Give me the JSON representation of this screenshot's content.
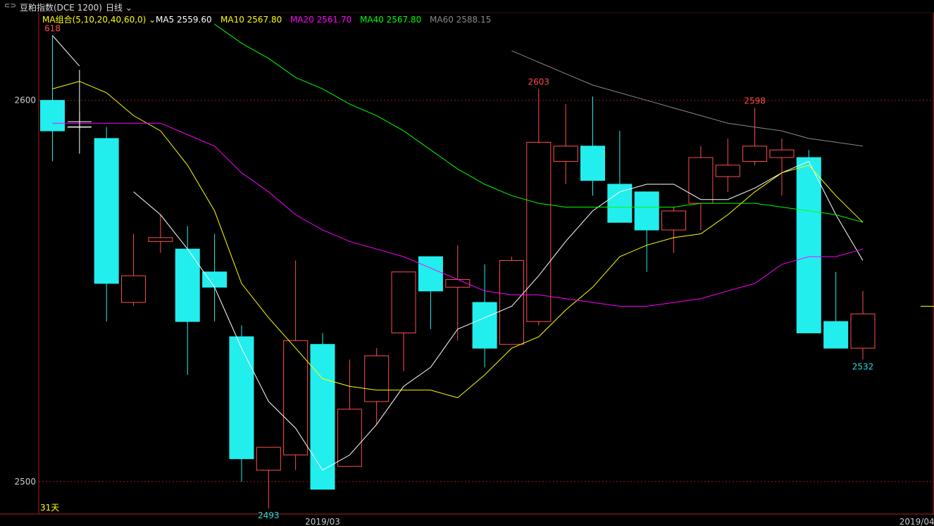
{
  "header": {
    "link_icon": "link-icon",
    "instrument": "豆粕指数(DCE 1200)",
    "period": "日线",
    "period_icon": "chevron-down-icon"
  },
  "legend": {
    "group": "MA组合(5,10,20,40,60,0)",
    "group_icon": "chevron-down-icon",
    "items": [
      {
        "text": "MA5 2559.60",
        "color": "#ffffff"
      },
      {
        "text": "MA10 2567.80",
        "color": "#ffff00"
      },
      {
        "text": "MA20 2561.70",
        "color": "#ff00ff"
      },
      {
        "text": "MA40 2567.80",
        "color": "#00ff00"
      },
      {
        "text": "MA60 2588.15",
        "color": "#888888"
      }
    ]
  },
  "chart_data": {
    "type": "candlestick",
    "ylim": [
      2491.5,
      2623
    ],
    "y_ticks": [
      2500,
      2600
    ],
    "x_ticks": [
      {
        "label": "2019/03",
        "index": 10
      },
      {
        "label": "2019/04",
        "index": 32
      }
    ],
    "candles": [
      {
        "open": 2600,
        "high": 2617,
        "low": 2584,
        "close": 2592
      },
      {
        "open": 2593,
        "high": 2608,
        "low": 2586,
        "close": 2593
      },
      {
        "open": 2590,
        "high": 2593,
        "low": 2542,
        "close": 2552
      },
      {
        "open": 2547,
        "high": 2565,
        "low": 2546,
        "close": 2554
      },
      {
        "open": 2563,
        "high": 2570,
        "low": 2560,
        "close": 2564
      },
      {
        "open": 2561,
        "high": 2567,
        "low": 2528,
        "close": 2542
      },
      {
        "open": 2555,
        "high": 2565,
        "low": 2542,
        "close": 2551
      },
      {
        "open": 2538,
        "high": 2541,
        "low": 2500,
        "close": 2506
      },
      {
        "open": 2503,
        "high": 2508,
        "low": 2493,
        "close": 2509
      },
      {
        "open": 2507,
        "high": 2558,
        "low": 2503,
        "close": 2537
      },
      {
        "open": 2536,
        "high": 2539,
        "low": 2503,
        "close": 2498
      },
      {
        "open": 2504,
        "high": 2532,
        "low": 2504,
        "close": 2519
      },
      {
        "open": 2521,
        "high": 2535,
        "low": 2515,
        "close": 2533
      },
      {
        "open": 2539,
        "high": 2551,
        "low": 2529,
        "close": 2555
      },
      {
        "open": 2559,
        "high": 2559,
        "low": 2540,
        "close": 2550
      },
      {
        "open": 2551,
        "high": 2562,
        "low": 2537,
        "close": 2553
      },
      {
        "open": 2547,
        "high": 2557,
        "low": 2530,
        "close": 2535
      },
      {
        "open": 2536,
        "high": 2559,
        "low": 2536,
        "close": 2558
      },
      {
        "open": 2542,
        "high": 2603,
        "low": 2541,
        "close": 2589
      },
      {
        "open": 2584,
        "high": 2599,
        "low": 2578,
        "close": 2588
      },
      {
        "open": 2588,
        "high": 2601,
        "low": 2575,
        "close": 2579
      },
      {
        "open": 2578,
        "high": 2592,
        "low": 2569,
        "close": 2568
      },
      {
        "open": 2576,
        "high": 2576,
        "low": 2555,
        "close": 2566
      },
      {
        "open": 2566,
        "high": 2572,
        "low": 2560,
        "close": 2571
      },
      {
        "open": 2573,
        "high": 2588,
        "low": 2566,
        "close": 2585
      },
      {
        "open": 2580,
        "high": 2590,
        "low": 2576,
        "close": 2583
      },
      {
        "open": 2584,
        "high": 2598,
        "low": 2583,
        "close": 2588
      },
      {
        "open": 2585,
        "high": 2590,
        "low": 2575,
        "close": 2587
      },
      {
        "open": 2585,
        "high": 2587,
        "low": 2540,
        "close": 2539
      },
      {
        "open": 2542,
        "high": 2555,
        "low": 2539,
        "close": 2535
      },
      {
        "open": 2535,
        "high": 2550,
        "low": 2532,
        "close": 2544
      }
    ],
    "ma_lines": [
      {
        "name": "MA5",
        "color": "#ffffff",
        "values": [
          2617,
          2609,
          null,
          2576,
          2570,
          2561,
          2551,
          2535,
          2521,
          2514,
          2503,
          2507,
          2515,
          2525,
          2530,
          2540,
          2543,
          2546,
          2554,
          2563,
          2571,
          2576,
          2578,
          2578,
          2574,
          2574,
          2577,
          2581,
          2584,
          2570,
          2558
        ]
      },
      {
        "name": "MA10",
        "color": "#ffff00",
        "values": [
          2603,
          2605,
          2602,
          2596,
          2592,
          2583,
          2571,
          2552,
          2543,
          2535,
          2527,
          2525,
          2524,
          2524,
          2524,
          2522,
          2528,
          2535,
          2538,
          2545,
          2551,
          2559,
          2562,
          2564,
          2565,
          2570,
          2576,
          2581,
          2583,
          2575,
          2568
        ]
      },
      {
        "name": "MA20",
        "color": "#ff00ff",
        "values": [
          2594,
          2594,
          2594,
          2594,
          2594,
          2591,
          2588,
          2581,
          2576,
          2570,
          2566,
          2563,
          2561,
          2559,
          2556,
          2553,
          2550,
          2549,
          2549,
          2548,
          2547,
          2546,
          2546,
          2547,
          2548,
          2550,
          2552,
          2557,
          2559,
          2559,
          2561
        ]
      },
      {
        "name": "MA40",
        "color": "#00ff00",
        "values": [
          null,
          null,
          null,
          null,
          null,
          null,
          2620,
          2615,
          2611,
          2606,
          2603,
          2599,
          2596,
          2592,
          2587,
          2582,
          2578,
          2575,
          2573,
          2572,
          2572,
          2572,
          2572,
          2572,
          2573,
          2573,
          2573,
          2572,
          2571,
          2570,
          2568
        ]
      },
      {
        "name": "MA60",
        "color": "#888888",
        "values": [
          null,
          null,
          null,
          null,
          null,
          null,
          null,
          null,
          null,
          null,
          null,
          null,
          null,
          null,
          null,
          null,
          null,
          2613,
          2610,
          2607,
          2604,
          2602,
          2600,
          2598,
          2596,
          2594,
          2593,
          2592,
          2590,
          2589,
          2588
        ]
      }
    ],
    "annotations": [
      {
        "text": "618",
        "index": 0,
        "value": 2617,
        "color": "#ff4d4d"
      },
      {
        "text": "2603",
        "index": 18,
        "value": 2603,
        "color": "#ff4d4d"
      },
      {
        "text": "2598",
        "index": 26,
        "value": 2598,
        "color": "#ff4d4d"
      },
      {
        "text": "2493",
        "index": 8,
        "value": 2493,
        "color": "#22dddd"
      },
      {
        "text": "2532",
        "index": 30,
        "value": 2532,
        "color": "#22dddd"
      }
    ],
    "footer_left": "31天",
    "last_price": 2546
  }
}
